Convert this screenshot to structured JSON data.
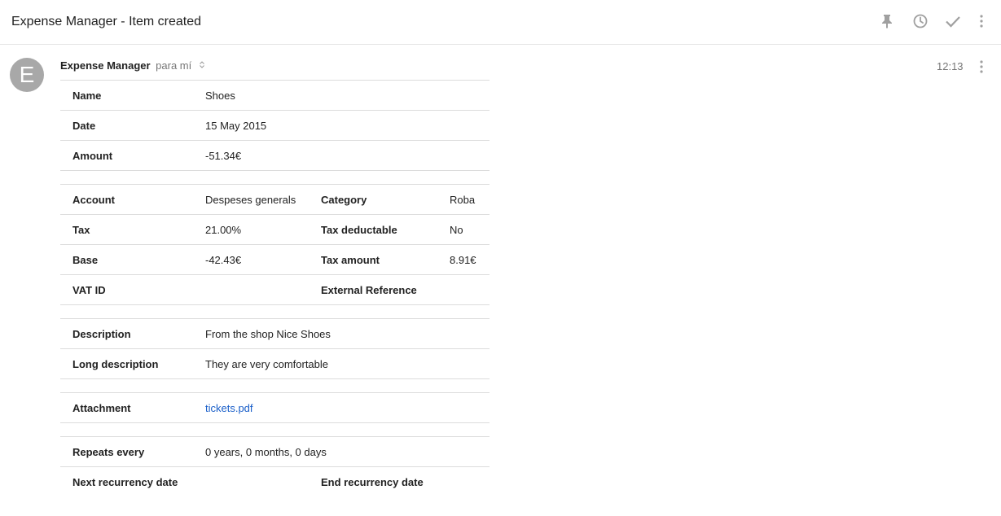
{
  "header": {
    "subject": "Expense Manager - Item created",
    "icons": [
      "pin-icon",
      "clock-icon",
      "check-icon",
      "more-vert-icon"
    ]
  },
  "message": {
    "avatar_letter": "E",
    "sender": "Expense Manager",
    "recipient": "para mí",
    "time": "12:13"
  },
  "details": {
    "name": {
      "label": "Name",
      "value": "Shoes"
    },
    "date": {
      "label": "Date",
      "value": "15 May 2015"
    },
    "amount": {
      "label": "Amount",
      "value": "-51.34€"
    },
    "account": {
      "label": "Account",
      "value": "Despeses generals"
    },
    "category": {
      "label": "Category",
      "value": "Roba"
    },
    "tax": {
      "label": "Tax",
      "value": "21.00%"
    },
    "tax_deductable": {
      "label": "Tax deductable",
      "value": "No"
    },
    "base": {
      "label": "Base",
      "value": "-42.43€"
    },
    "tax_amount": {
      "label": "Tax amount",
      "value": "8.91€"
    },
    "vat_id": {
      "label": "VAT ID",
      "value": ""
    },
    "external_reference": {
      "label": "External Reference",
      "value": ""
    },
    "description": {
      "label": "Description",
      "value": "From the shop Nice Shoes"
    },
    "long_description": {
      "label": "Long description",
      "value": "They are very comfortable"
    },
    "attachment": {
      "label": "Attachment",
      "value": "tickets.pdf"
    },
    "repeats_every": {
      "label": "Repeats every",
      "value": "0 years, 0 months, 0 days"
    },
    "next_recurrency_date": {
      "label": "Next recurrency date",
      "value": ""
    },
    "end_recurrency_date": {
      "label": "End recurrency date",
      "value": ""
    }
  },
  "colors": {
    "link": "#1a5fc9",
    "icon": "#a0a0a0",
    "avatar": "#a8a8a8",
    "divider": "#dcdcdc"
  }
}
